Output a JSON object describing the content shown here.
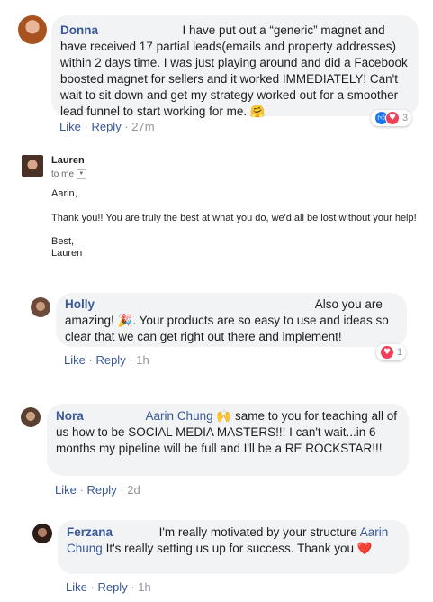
{
  "comments": [
    {
      "name": "Donna",
      "text": "I have put out a “generic” magnet and have received 17 partial leads(emails and property addresses) within 2 days time. I was just playing around and did a Facebook boosted magnet for sellers and it worked IMMEDIATELY! Can't wait to sit down and get my strategy worked out for a smoother lead funnel to start working for me.",
      "emoji": "🤗",
      "like": "Like",
      "reply": "Reply",
      "sep": "·",
      "time": "27m",
      "reaction_count": "3"
    },
    {
      "name": "Holly",
      "text_before": "Also you are amazing!",
      "emoji": "🎉",
      "text_after": ". Your products are so easy to use and ideas so clear that we can get right out there and implement!",
      "like": "Like",
      "reply": "Reply",
      "sep": "·",
      "time": "1h",
      "reaction_count": "1"
    },
    {
      "name": "Nora",
      "mention": "Aarin Chung",
      "emoji": "🙌",
      "text": "same to you for teaching all of us how to be SOCIAL MEDIA MASTERS!!! I can't wait...in 6 months my pipeline will be full and I'll be a RE ROCKSTAR!!!",
      "like": "Like",
      "reply": "Reply",
      "sep": "·",
      "time": "2d"
    },
    {
      "name": "Ferzana",
      "text_before": "I'm really motivated by your structure",
      "mention": "Aarin Chung",
      "text_after": "It's really setting us up for success. Thank you",
      "emoji": "❤️",
      "like": "Like",
      "reply": "Reply",
      "sep": "·",
      "time": "1h"
    }
  ],
  "email": {
    "sender": "Lauren",
    "to": "to me",
    "greeting": "Aarin,",
    "body": "Thank you!! You are truly the best at what you do, we'd all be lost without your help!",
    "signoff": "Best,",
    "signature": "Lauren"
  },
  "colors": {
    "link": "#385898",
    "bubble": "#f2f3f5",
    "like_reaction": "#1877f2",
    "love_reaction": "#f33e58"
  }
}
